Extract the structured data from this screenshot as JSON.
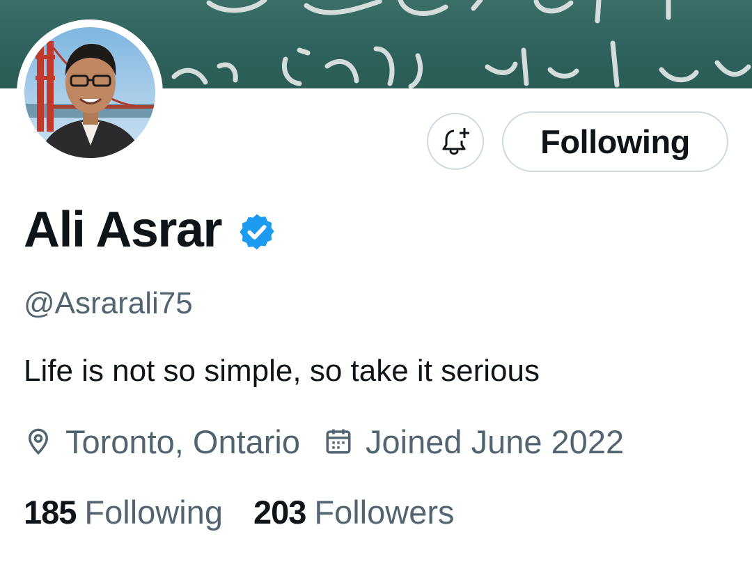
{
  "banner": {
    "background_color": "#2f625c",
    "ink_color": "#e6ebea"
  },
  "avatar": {
    "icon": "profile-photo"
  },
  "actions": {
    "notify_icon": "bell-plus-icon",
    "following_label": "Following"
  },
  "profile": {
    "name": "Ali Asrar",
    "verified_icon": "verified-badge-icon",
    "verified_color": "#1d9bf0",
    "handle": "@Asrarali75",
    "bio": "Life is not so simple, so take it serious",
    "location": "Toronto, Ontario",
    "location_icon": "location-pin-icon",
    "joined": "Joined June 2022",
    "joined_icon": "calendar-icon"
  },
  "stats": {
    "following_count": "185",
    "following_label": "Following",
    "followers_count": "203",
    "followers_label": "Followers"
  }
}
